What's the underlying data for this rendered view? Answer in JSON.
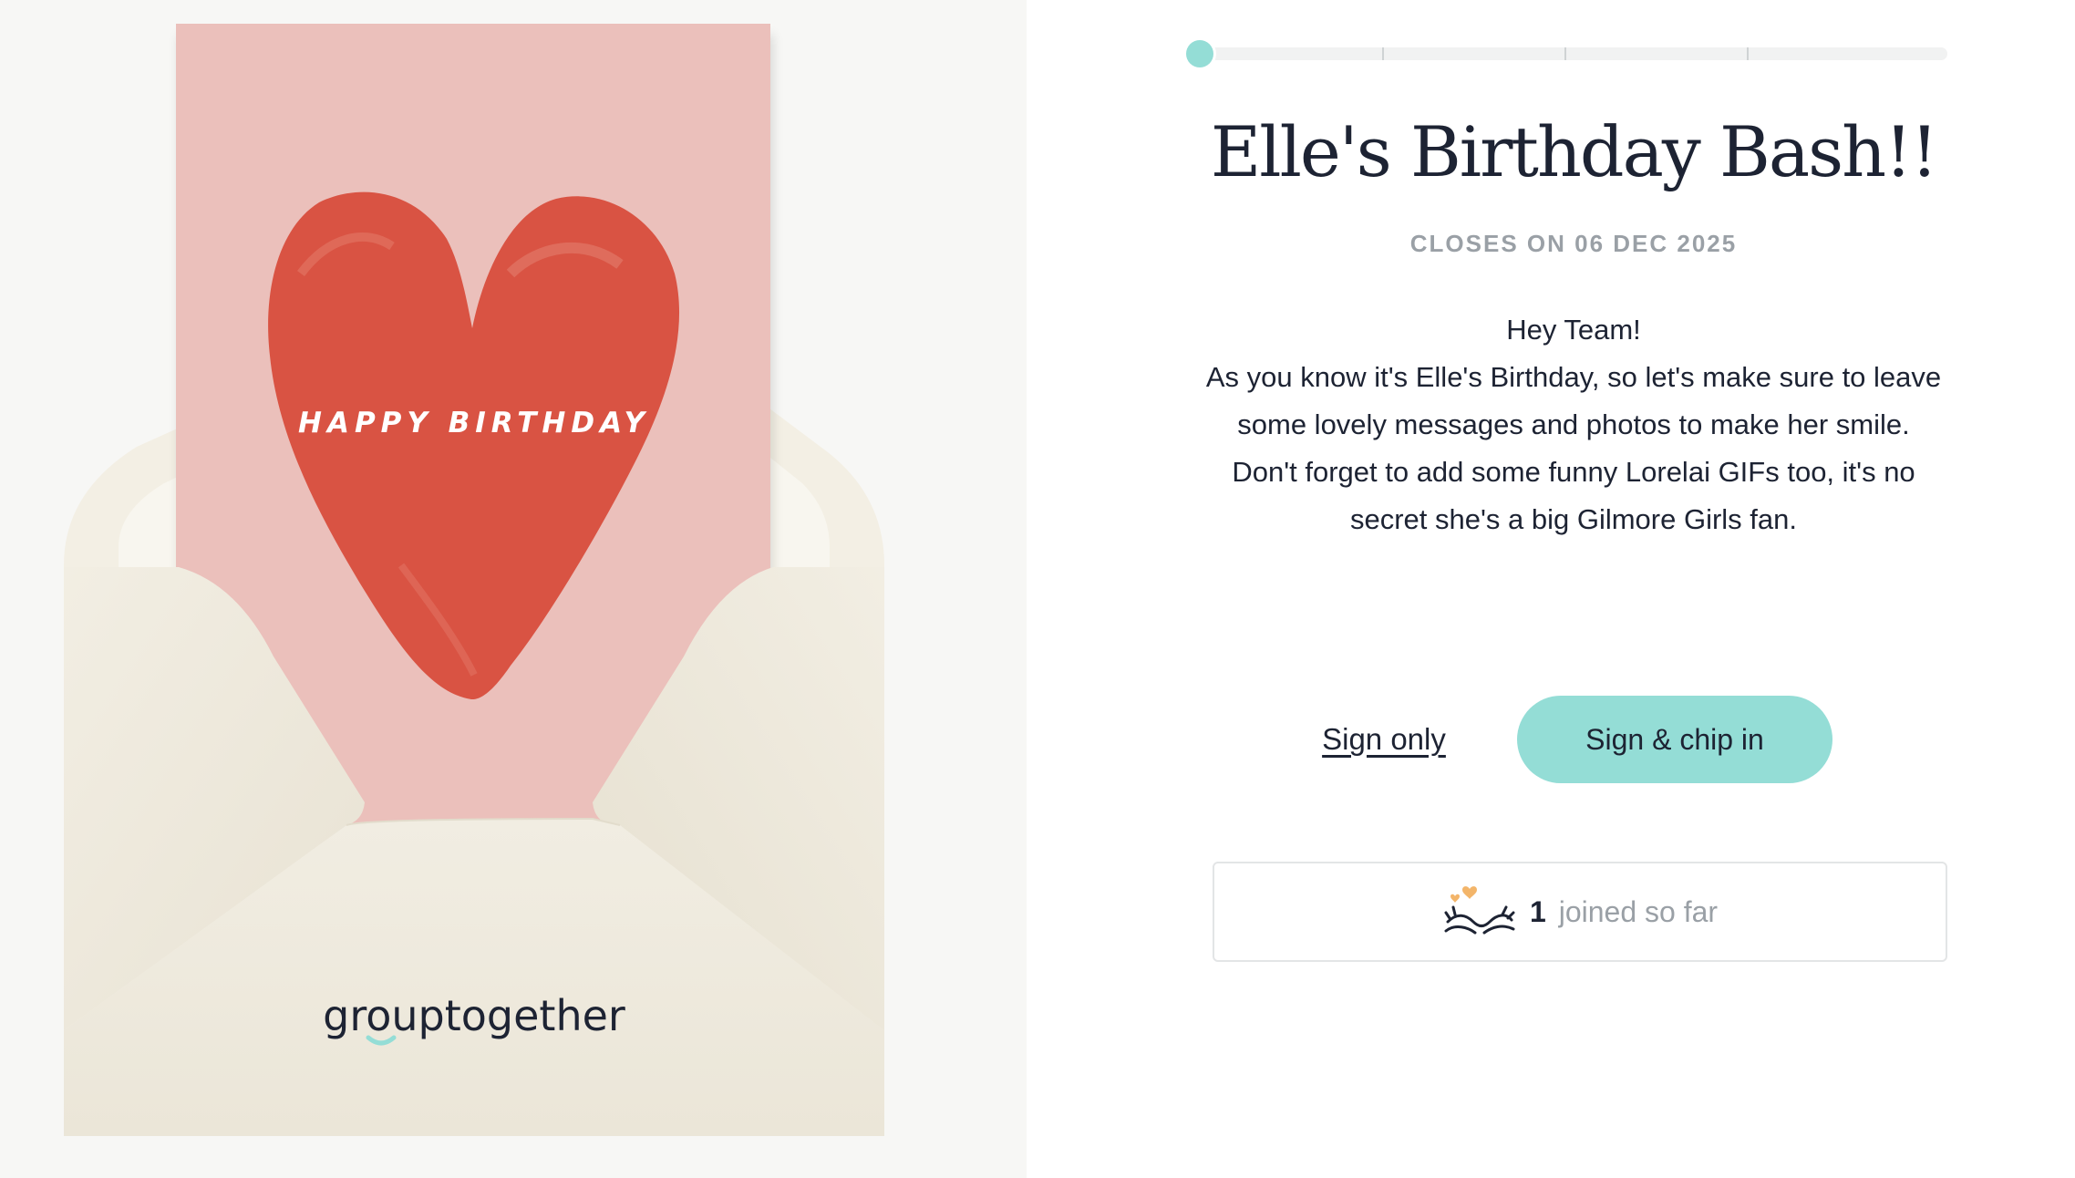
{
  "card": {
    "greeting": "HAPPY BIRTHDAY",
    "brand": "grouptogether"
  },
  "progress": {
    "fraction": 0.0,
    "steps": 5
  },
  "event": {
    "title": "Elle's Birthday Bash!!",
    "closes": "CLOSES ON 06 DEC 2025"
  },
  "message": {
    "lines": [
      "Hey Team!",
      "As you know it's Elle's Birthday, so let's make sure to leave some lovely messages and photos to make her smile.",
      "Don't forget to add some funny Lorelai GIFs too, it's no secret she's a big Gilmore Girls fan."
    ]
  },
  "actions": {
    "sign_only": "Sign only",
    "chip_in": "Sign & chip in"
  },
  "joined": {
    "count": "1",
    "label": "joined so far",
    "icon": "hug-hands-icon"
  },
  "colors": {
    "accent": "#94ddd6",
    "text": "#1d2333",
    "muted": "#9aa0a6",
    "card_pink": "#ebc0bb",
    "heart_red": "#d95343",
    "envelope": "#efebe0"
  }
}
